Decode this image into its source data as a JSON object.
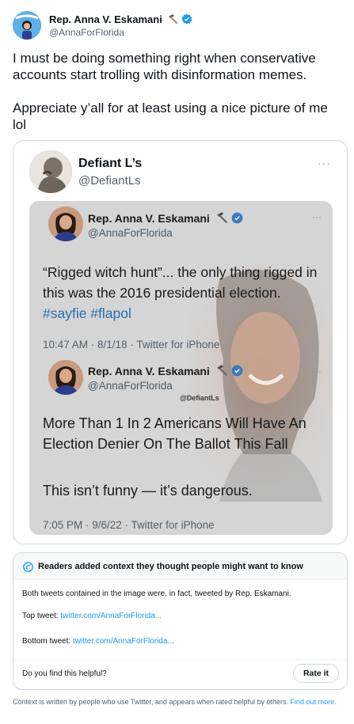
{
  "colors": {
    "link": "#1d9bf0",
    "verified": "#1d9bf0",
    "hashtag": "#2a6fb0"
  },
  "author": {
    "name": "Rep. Anna V. Eskamani",
    "handle": "@AnnaForFlorida",
    "avatar_text": "ANNA ESKAMANI",
    "icons": [
      "hammer-icon",
      "verified-badge-icon"
    ]
  },
  "tweet": {
    "text": "I must be doing something right when conservative accounts start trolling with disinformation memes.\n\nAppreciate y’all for at least using a nice picture of me lol"
  },
  "quote": {
    "name": "Defiant L’s",
    "handle": "@DefiantLs",
    "more": "···",
    "meme": {
      "tweet1": {
        "name": "Rep. Anna V. Eskamani",
        "handle": "@AnnaForFlorida",
        "text_a": "“Rigged witch hunt”... the only thing rigged in this was the 2016  presidential election. ",
        "hashtags": "#sayfie #flapol",
        "time": "10:47 AM · 8/1/18 · Twitter for iPhone"
      },
      "tweet2": {
        "name": "Rep. Anna V. Eskamani",
        "handle": "@AnnaForFlorida",
        "watermark": "@DefiantLs",
        "headline": "More Than 1 In 2 Americans Will Have An Election Denier On The Ballot This Fall",
        "comment": "This isn’t funny — it’s dangerous.",
        "time": "7:05 PM · 9/6/22 · Twitter for iPhone"
      }
    }
  },
  "community_note": {
    "title": "Readers added context they thought people might want to know",
    "body": "Both tweets contained in the image were, in fact, tweeted by Rep. Eskamani.",
    "top_label": "Top tweet: ",
    "top_link": "twitter.com/AnnaForFlorida...",
    "bottom_label": "Bottom tweet: ",
    "bottom_link": "twitter.com/AnnaForFlorida...",
    "helpful_question": "Do you find this helpful?",
    "rate_button": "Rate it"
  },
  "footer": {
    "text": "Context is written by people who use Twitter, and appears when rated helpful by others. ",
    "link": "Find out more."
  }
}
